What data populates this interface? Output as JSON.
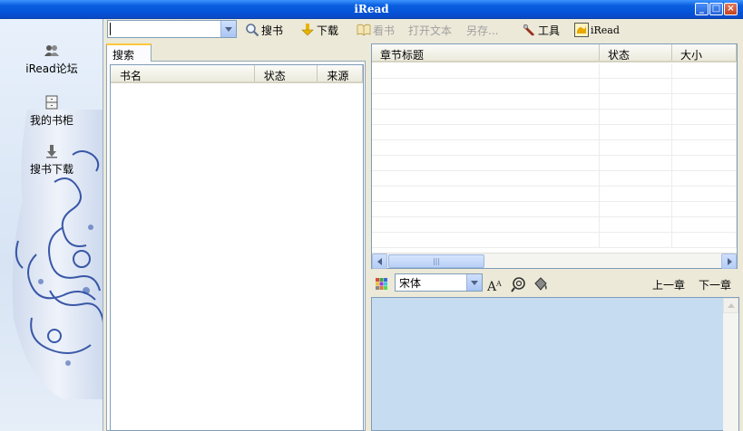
{
  "window": {
    "title": "iRead"
  },
  "sidebar": {
    "items": [
      {
        "label": "iRead论坛",
        "icon": "people-icon"
      },
      {
        "label": "我的书柜",
        "icon": "bookcase-icon"
      },
      {
        "label": "搜书下载",
        "icon": "download-arrow-icon"
      }
    ]
  },
  "toolbar": {
    "search_value": "",
    "items": [
      {
        "label": "搜书",
        "icon": "magnifier-icon",
        "enabled": true
      },
      {
        "label": "下载",
        "icon": "download-icon",
        "enabled": true
      },
      {
        "label": "看书",
        "icon": "open-book-icon",
        "enabled": false
      },
      {
        "label": "打开文本",
        "icon": "",
        "enabled": false
      },
      {
        "label": "另存...",
        "icon": "",
        "enabled": false
      },
      {
        "label": "工具",
        "icon": "wrench-icon",
        "enabled": true
      },
      {
        "label": "iRead",
        "icon": "iread-logo-icon",
        "enabled": true
      }
    ]
  },
  "search_pane": {
    "tab_label": "搜索",
    "columns": [
      "书名",
      "状态",
      "来源"
    ],
    "rows": []
  },
  "chapter_list": {
    "columns": [
      "章节标题",
      "状态",
      "大小"
    ],
    "rows": []
  },
  "reader": {
    "font_value": "宋体",
    "prev_chapter": "上一章",
    "next_chapter": "下一章",
    "content": ""
  },
  "colors": {
    "titlebar": "#0553d8",
    "reader_bg": "#c6dcf1",
    "window_bg": "#ece9d8"
  }
}
